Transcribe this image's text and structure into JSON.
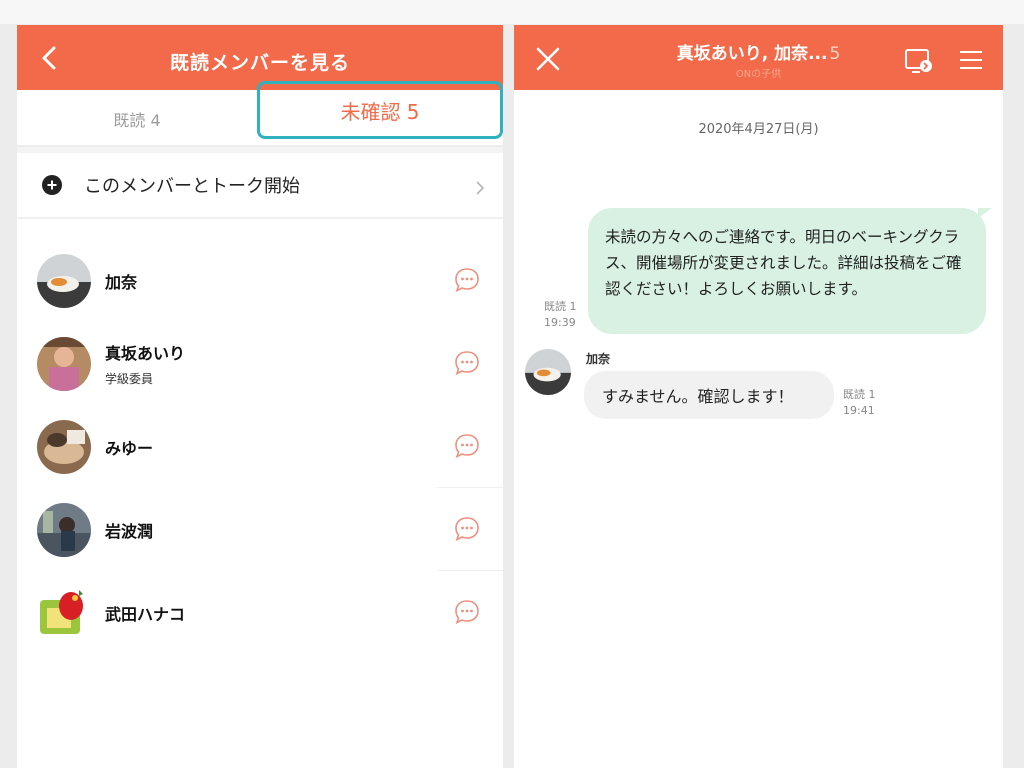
{
  "colors": {
    "accent": "#f26a4a",
    "highlight_border": "#2fb2c0",
    "outgoing_bubble": "#d8f1e3",
    "incoming_bubble": "#f1f1f1"
  },
  "left_panel": {
    "header": {
      "title": "既読メンバーを見る",
      "back_icon": "chevron-left-icon"
    },
    "tabs": [
      {
        "label": "既読 4",
        "selected": false
      },
      {
        "label": "未確認 5",
        "selected": true
      }
    ],
    "start_talk": {
      "label": "このメンバーとトーク開始",
      "icon": "chat-plus-icon"
    },
    "members": [
      {
        "name": "加奈",
        "role": ""
      },
      {
        "name": "真坂あいり",
        "role": "学級委員"
      },
      {
        "name": "みゆー",
        "role": ""
      },
      {
        "name": "岩波潤",
        "role": ""
      },
      {
        "name": "武田ハナコ",
        "role": ""
      }
    ]
  },
  "right_panel": {
    "header": {
      "title": "真坂あいり, 加奈...",
      "member_count": "5",
      "subtitle": "ONの子供",
      "close_icon": "close-icon",
      "screen_icon": "screen-share-icon",
      "menu_icon": "menu-icon"
    },
    "date": "2020年4月27日(月)",
    "messages": [
      {
        "direction": "out",
        "text": "未読の方々へのご連絡です。明日のベーキングクラス、開催場所が変更されました。詳細は投稿をご確認ください！よろしくお願いします。",
        "read_status": "既読 1",
        "time": "19:39"
      },
      {
        "direction": "in",
        "sender": "加奈",
        "text": "すみません。確認します！",
        "read_status": "既読 1",
        "time": "19:41"
      }
    ]
  }
}
